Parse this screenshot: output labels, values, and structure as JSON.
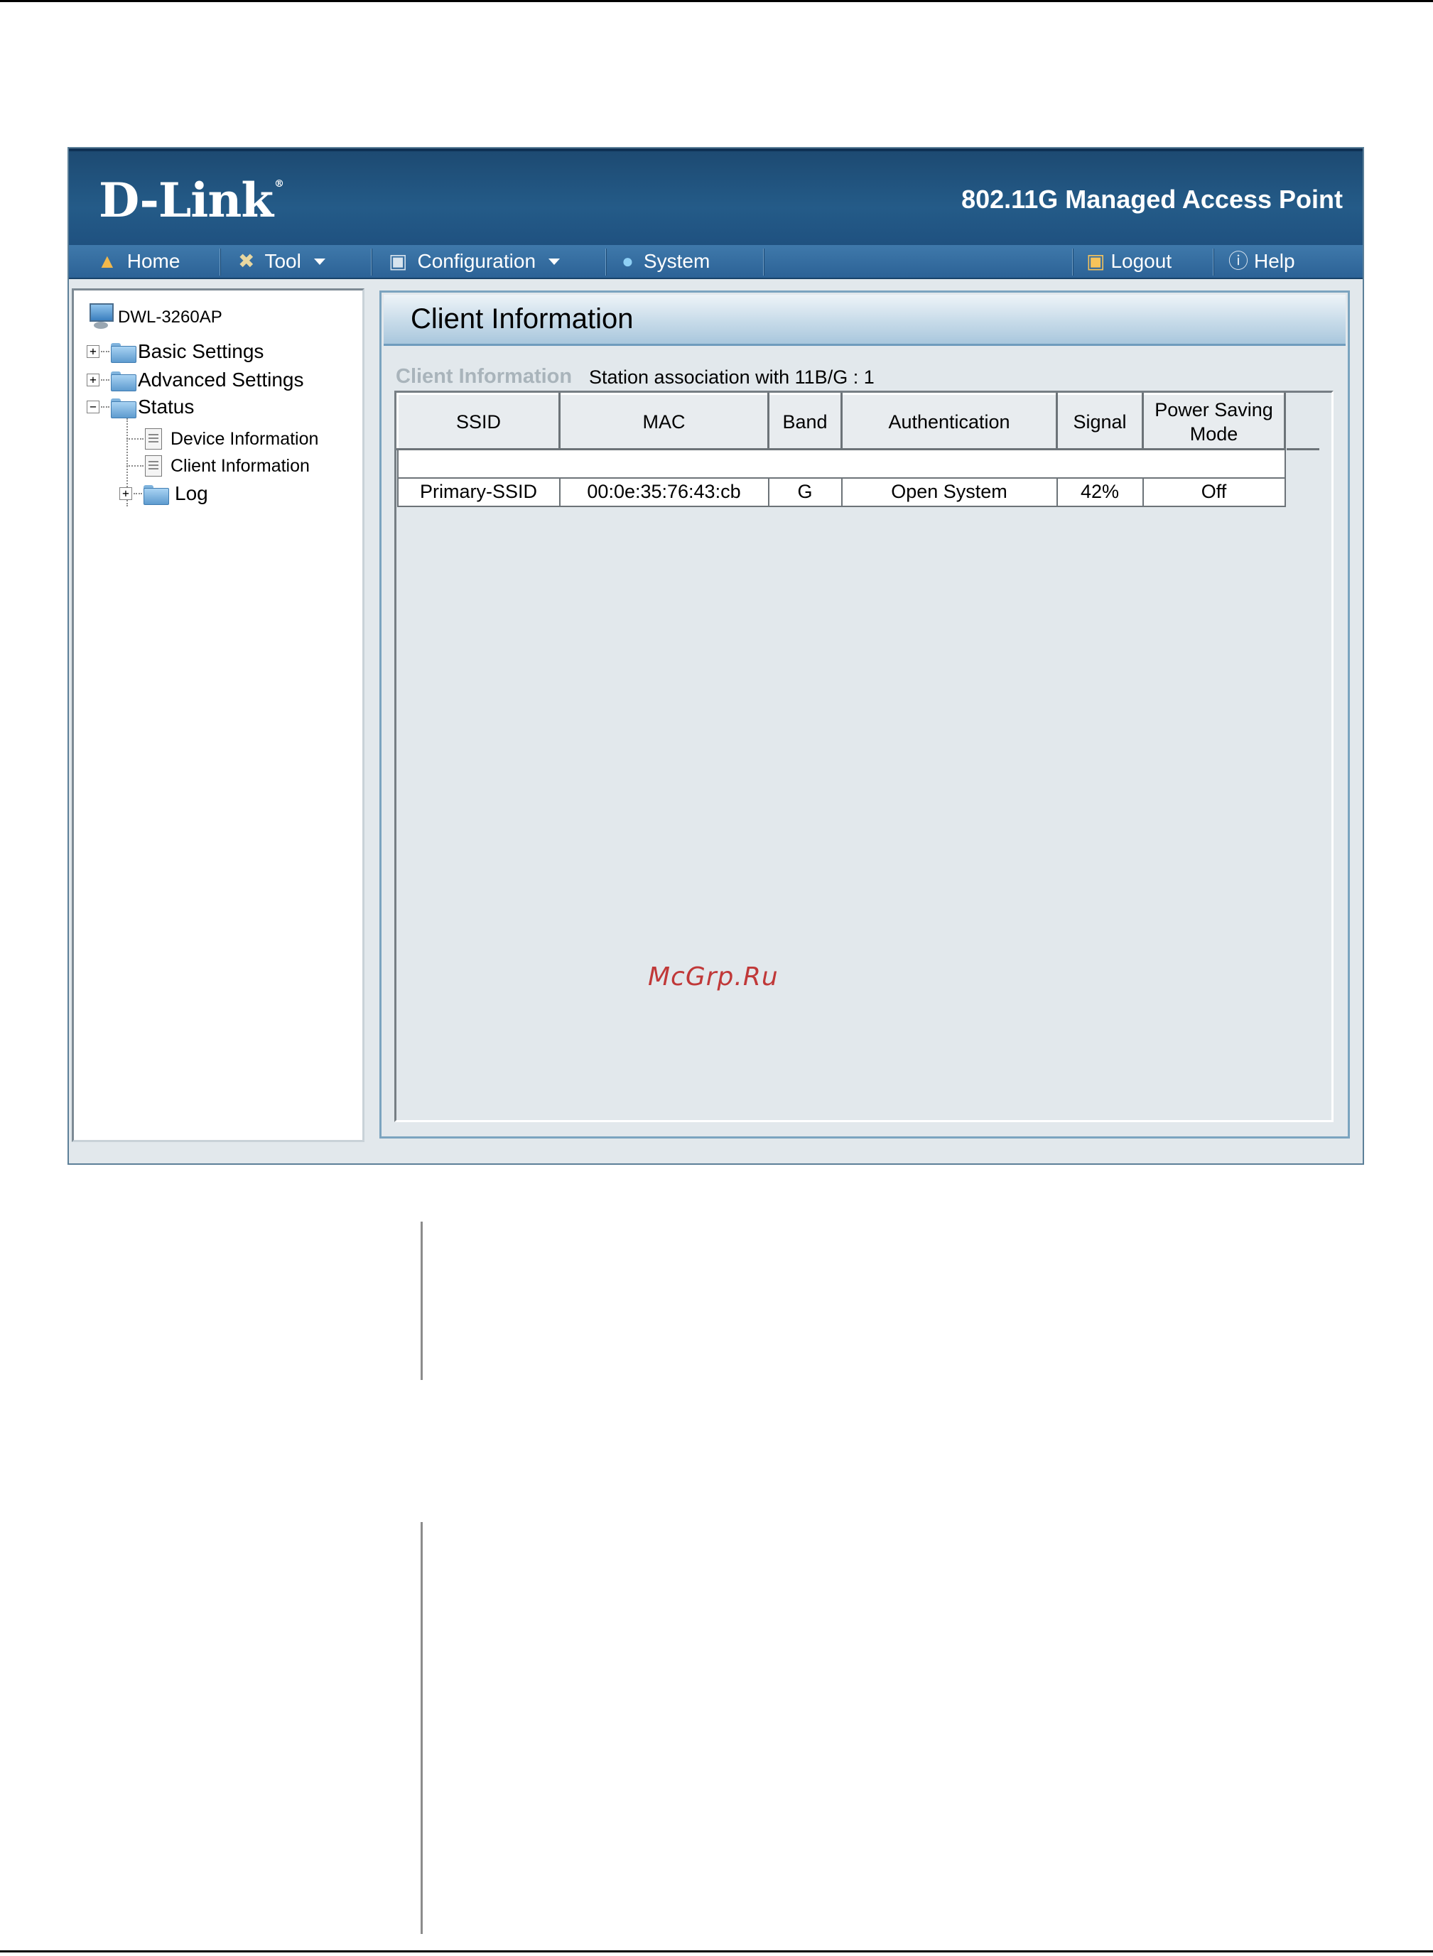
{
  "header": {
    "logo_text": "D-Link",
    "logo_mark": "®",
    "product_title": "802.11G Managed Access Point"
  },
  "menu": {
    "home": {
      "label": "Home",
      "icon": "home-icon"
    },
    "tool": {
      "label": "Tool",
      "icon": "tools-icon"
    },
    "configuration": {
      "label": "Configuration",
      "icon": "floppy-disk-icon"
    },
    "system": {
      "label": "System",
      "icon": "globe-icon"
    },
    "logout": {
      "label": "Logout",
      "icon": "key-icon"
    },
    "help": {
      "label": "Help",
      "icon": "help-icon"
    }
  },
  "tree": {
    "root": "DWL-3260AP",
    "basic_settings": "Basic Settings",
    "advanced_settings": "Advanced Settings",
    "status": "Status",
    "device_information": "Device Information",
    "client_information": "Client Information",
    "log": "Log",
    "expand_plus": "+",
    "expand_minus": "−"
  },
  "content": {
    "title": "Client Information",
    "section_label": "Client Information",
    "association_text": "Station association with 11B/G : 1"
  },
  "table": {
    "headers": [
      "SSID",
      "MAC",
      "Band",
      "Authentication",
      "Signal",
      "Power Saving Mode"
    ],
    "rows": [
      [
        "Primary-SSID",
        "00:0e:35:76:43:cb",
        "G",
        "Open System",
        "42%",
        "Off"
      ]
    ]
  },
  "watermark": "McGrp.Ru",
  "colors": {
    "header_blue": "#245b88",
    "menubar_blue": "#3f79ab",
    "pane_background": "#e2e8ec",
    "section_label_gray": "#a9b4bb",
    "watermark_red": "#c03838"
  }
}
